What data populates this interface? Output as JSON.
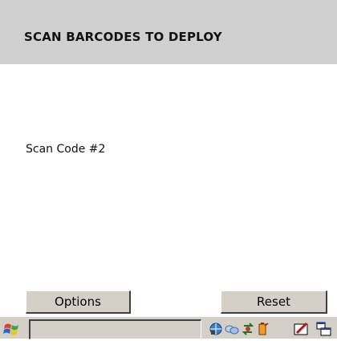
{
  "header": {
    "title": "SCAN BARCODES TO DEPLOY"
  },
  "main": {
    "status_text": "Scan Code #2"
  },
  "buttons": {
    "options_label": "Options",
    "reset_label": "Reset"
  },
  "taskbar": {
    "start_icon": "windows-flag-icon",
    "tray_icons": [
      "network-globe-icon",
      "connectivity-icon",
      "sync-icon",
      "battery-icon",
      "input-panel-icon",
      "window-switch-icon"
    ]
  }
}
